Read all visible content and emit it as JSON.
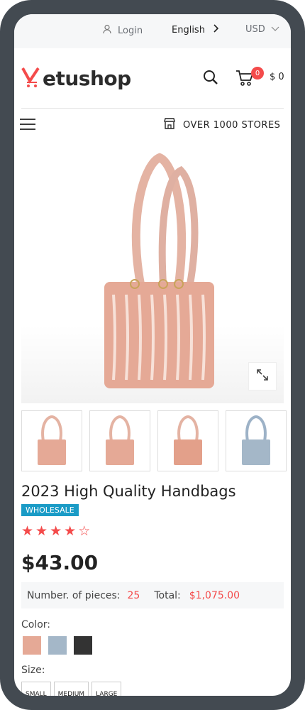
{
  "topbar": {
    "login": "Login",
    "language": "English",
    "currency": "USD"
  },
  "header": {
    "logo": "Vetushop",
    "cart_count": "0",
    "cart_total": "$ 0"
  },
  "nav": {
    "stores": "OVER 1000 STORES"
  },
  "product": {
    "title": "2023 High Quality Handbags",
    "badge": "WHOLESALE",
    "rating": 4,
    "rating_max": 5,
    "price": "$43.00",
    "pieces_label": "Number. of pieces:",
    "pieces_value": "25",
    "total_label": "Total:",
    "total_value": "$1,075.00",
    "color_label": "Color:",
    "colors": [
      "#e5a996",
      "#a4b7c8",
      "#333333"
    ],
    "size_label": "Size:",
    "sizes": [
      "SMALL",
      "MEDIUM",
      "LARGE"
    ]
  },
  "icons": {
    "login": "user-icon",
    "language_arrow": "chevron-right-icon",
    "currency_arrow": "chevron-down-icon",
    "search": "search-icon",
    "cart": "cart-icon",
    "menu": "hamburger-menu-icon",
    "store": "store-icon",
    "zoom": "expand-icon"
  },
  "colors": {
    "accent": "#f44b4b",
    "badge": "#1a9bc6",
    "frame": "#434a51"
  }
}
